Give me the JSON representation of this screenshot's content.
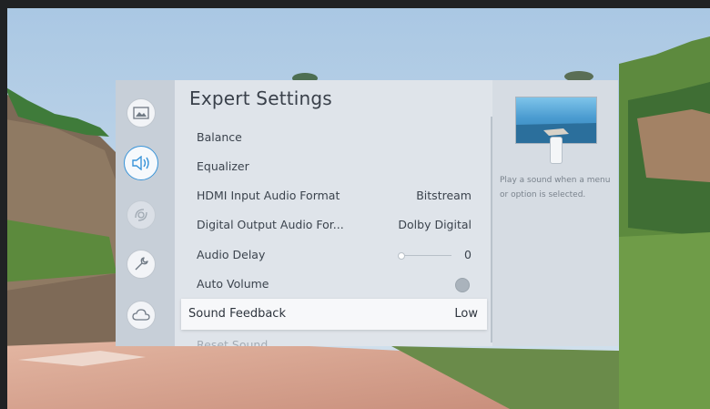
{
  "colors": {
    "accent": "#3a95d9",
    "panel_bg": "#dfe4ea",
    "selected_row": "#f7f8fa",
    "text": "#3b434d"
  },
  "sidebar": {
    "icons": [
      {
        "name": "picture-icon",
        "active": false
      },
      {
        "name": "sound-icon",
        "active": true
      },
      {
        "name": "broadcasting-icon",
        "active": false
      },
      {
        "name": "support-wrench-icon",
        "active": false
      },
      {
        "name": "cloud-icon",
        "active": false
      }
    ]
  },
  "menu": {
    "title": "Expert Settings",
    "items": [
      {
        "label": "Balance",
        "value": ""
      },
      {
        "label": "Equalizer",
        "value": ""
      },
      {
        "label": "HDMI Input Audio Format",
        "value": "Bitstream"
      },
      {
        "label": "Digital Output Audio For...",
        "value": "Dolby Digital"
      },
      {
        "label": "Audio Delay",
        "value": "0",
        "control": "slider",
        "level": 0
      },
      {
        "label": "Auto Volume",
        "value": "",
        "control": "toggle",
        "on": false
      },
      {
        "label": "Sound Feedback",
        "value": "Low",
        "selected": true
      },
      {
        "label": "Reset Sound",
        "value": ""
      }
    ]
  },
  "info": {
    "description": "Play a sound when a menu or option is selected."
  }
}
